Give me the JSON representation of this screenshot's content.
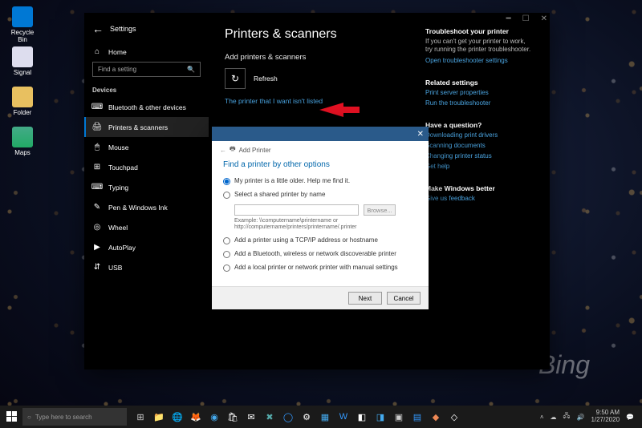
{
  "desktop": {
    "bing_wm": "Bing",
    "icons": {
      "recycle": "Recycle Bin",
      "signal": "Signal",
      "folder": "Folder",
      "maps": "Maps"
    }
  },
  "settings": {
    "title": "Settings",
    "search_placeholder": "Find a setting",
    "section": "Devices",
    "nav": {
      "home": "Home"
    },
    "items": [
      {
        "icon": "⌨",
        "label": "Bluetooth & other devices"
      },
      {
        "icon": "🖨",
        "label": "Printers & scanners",
        "active": true
      },
      {
        "icon": "🖱",
        "label": "Mouse"
      },
      {
        "icon": "⊞",
        "label": "Touchpad"
      },
      {
        "icon": "⌨",
        "label": "Typing"
      },
      {
        "icon": "✎",
        "label": "Pen & Windows Ink"
      },
      {
        "icon": "◎",
        "label": "Wheel"
      },
      {
        "icon": "▶",
        "label": "AutoPlay"
      },
      {
        "icon": "⇵",
        "label": "USB"
      }
    ],
    "page": {
      "h1": "Printers & scanners",
      "h2": "Add printers & scanners",
      "refresh": "Refresh",
      "not_listed": "The printer that I want isn't listed"
    },
    "right": {
      "troubleshoot_h": "Troubleshoot your printer",
      "troubleshoot_t": "If you can't get your printer to work, try running the printer troubleshooter.",
      "troubleshoot_l": "Open troubleshooter settings",
      "related_h": "Related settings",
      "related_l1": "Print server properties",
      "related_l2": "Run the troubleshooter",
      "question_h": "Have a question?",
      "q1": "Downloading print drivers",
      "q2": "Scanning documents",
      "q3": "Changing printer status",
      "q4": "Get help",
      "better_h": "Make Windows better",
      "better_l": "Give us feedback"
    }
  },
  "wizard": {
    "crumb": "Add Printer",
    "heading": "Find a printer by other options",
    "opts": {
      "older": "My printer is a little older. Help me find it.",
      "shared": "Select a shared printer by name",
      "browse": "Browse...",
      "example": "Example: \\\\computername\\printername or http://computername/printers/printername/.printer",
      "tcpip": "Add a printer using a TCP/IP address or hostname",
      "bt": "Add a Bluetooth, wireless or network discoverable printer",
      "local": "Add a local printer or network printer with manual settings"
    },
    "next": "Next",
    "cancel": "Cancel"
  },
  "taskbar": {
    "search": "Type here to search",
    "time": "9:50 AM",
    "date": "1/27/2020"
  }
}
